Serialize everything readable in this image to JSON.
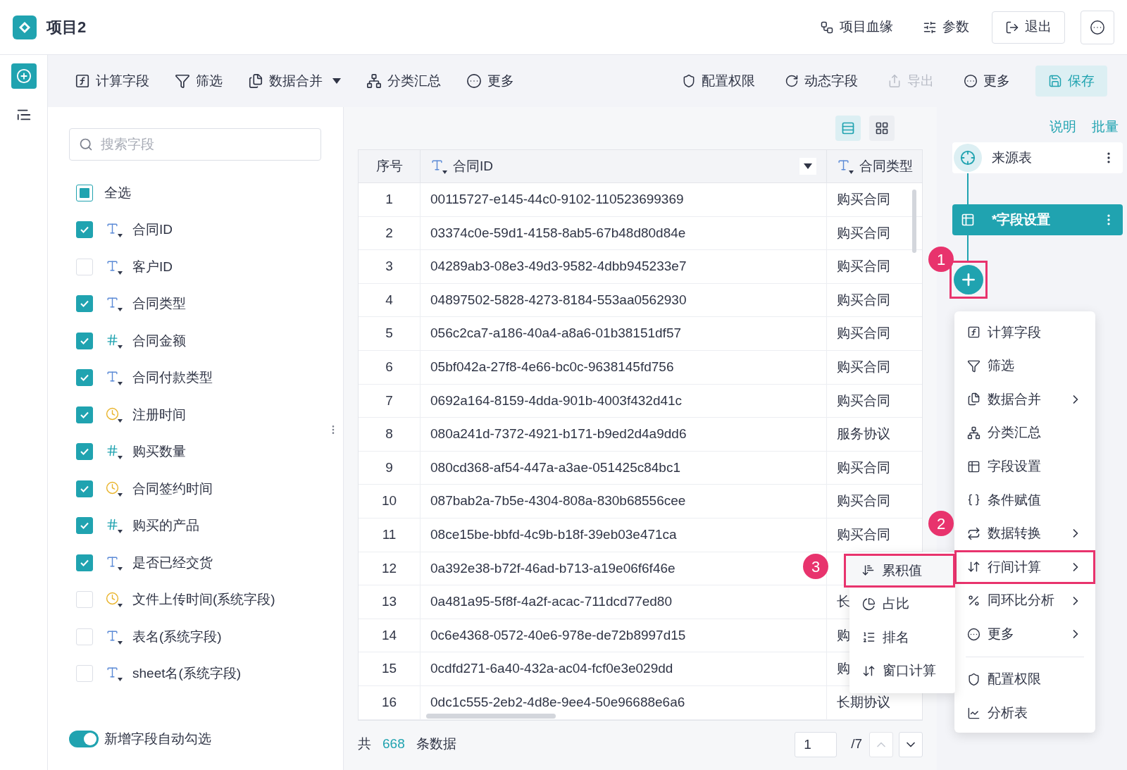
{
  "header": {
    "title": "项目2",
    "actions": [
      {
        "label": "项目血缘",
        "kind": "link"
      },
      {
        "label": "参数",
        "kind": "link"
      },
      {
        "label": "退出",
        "kind": "button"
      }
    ]
  },
  "toolbar": {
    "left": [
      {
        "label": "计算字段",
        "dropdown": false
      },
      {
        "label": "筛选",
        "dropdown": false
      },
      {
        "label": "数据合并",
        "dropdown": true
      },
      {
        "label": "分类汇总",
        "dropdown": false
      },
      {
        "label": "更多",
        "dropdown": false
      }
    ],
    "right": [
      {
        "label": "配置权限",
        "kind": "plain",
        "disabled": false
      },
      {
        "label": "动态字段",
        "kind": "plain",
        "disabled": false
      },
      {
        "label": "导出",
        "kind": "plain",
        "disabled": true
      },
      {
        "label": "更多",
        "kind": "plain",
        "disabled": false
      },
      {
        "label": "保存",
        "kind": "primary",
        "disabled": false
      }
    ]
  },
  "fields": {
    "search": {
      "placeholder": "搜索字段"
    },
    "select_all": {
      "label": "全选",
      "checked": false,
      "indeterminate": true
    },
    "items": [
      {
        "label": "合同ID",
        "kind": "text",
        "checked": true
      },
      {
        "label": "客户ID",
        "kind": "text",
        "checked": false
      },
      {
        "label": "合同类型",
        "kind": "text",
        "checked": true
      },
      {
        "label": "合同金额",
        "kind": "number",
        "checked": true
      },
      {
        "label": "合同付款类型",
        "kind": "text",
        "checked": true
      },
      {
        "label": "注册时间",
        "kind": "date",
        "checked": true
      },
      {
        "label": "购买数量",
        "kind": "number",
        "checked": true
      },
      {
        "label": "合同签约时间",
        "kind": "date",
        "checked": true
      },
      {
        "label": "购买的产品",
        "kind": "number",
        "checked": true
      },
      {
        "label": "是否已经交货",
        "kind": "text",
        "checked": true
      },
      {
        "label": "文件上传时间(系统字段)",
        "kind": "date",
        "checked": false
      },
      {
        "label": "表名(系统字段)",
        "kind": "text",
        "checked": false
      },
      {
        "label": "sheet名(系统字段)",
        "kind": "text",
        "checked": false
      }
    ],
    "auto_check": {
      "label": "新增字段自动勾选",
      "on": true
    }
  },
  "views": [
    {
      "kind": "list",
      "selected": true
    },
    {
      "kind": "grid",
      "selected": false
    }
  ],
  "table": {
    "columns": [
      {
        "label": "序号",
        "kind": "index",
        "filter": false
      },
      {
        "label": "合同ID",
        "kind": "text",
        "filter": true
      },
      {
        "label": "合同类型",
        "kind": "text",
        "filter": false
      }
    ],
    "rows": [
      [
        "1",
        "00115727-e145-44c0-9102-110523699369",
        "购买合同"
      ],
      [
        "2",
        "03374c0e-59d1-4158-8ab5-67b48d80d84e",
        "购买合同"
      ],
      [
        "3",
        "04289ab3-08e3-49d3-9582-4dbb945233e7",
        "购买合同"
      ],
      [
        "4",
        "04897502-5828-4273-8184-553aa0562930",
        "购买合同"
      ],
      [
        "5",
        "056c2ca7-a186-40a4-a8a6-01b38151df57",
        "购买合同"
      ],
      [
        "6",
        "05bf042a-27f8-4e66-bc0c-9638145fd756",
        "购买合同"
      ],
      [
        "7",
        "0692a164-8159-4dda-901b-4003f432d41c",
        "购买合同"
      ],
      [
        "8",
        "080a241d-7372-4921-b171-b9ed2d4a9dd6",
        "服务协议"
      ],
      [
        "9",
        "080cd368-af54-447a-a3ae-051425c84bc1",
        "购买合同"
      ],
      [
        "10",
        "087bab2a-7b5e-4304-808a-830b68556cee",
        "购买合同"
      ],
      [
        "11",
        "08ce15be-bbfd-4c9b-b18f-39eb03e471ca",
        "购买合同"
      ],
      [
        "12",
        "0a392e38-b72f-46ad-b713-a19e06f6f46e"
      ],
      [
        "13",
        "0a481a95-5f8f-4a2f-acac-711dcd77ed80",
        "长"
      ],
      [
        "14",
        "0c6e4368-0572-40e6-978e-de72b8997d15",
        "购"
      ],
      [
        "15",
        "0cdfd271-6a40-432a-ac04-fcf0e3e029dd",
        "购"
      ],
      [
        "16",
        "0dc1c555-2eb2-4d8e-9ee4-50e96688e6a6",
        "长期协议"
      ]
    ]
  },
  "footer": {
    "prefix": "共",
    "count": "668",
    "suffix": "条数据",
    "page": "1",
    "pages": "/7"
  },
  "flow": {
    "links": [
      "说明",
      "批量"
    ],
    "nodes": [
      {
        "label": "来源表",
        "kind": "source",
        "selected": false
      },
      {
        "label": "*字段设置",
        "kind": "fields",
        "selected": true
      }
    ]
  },
  "menu": {
    "items": [
      {
        "label": "计算字段",
        "submenu": false,
        "highlighted": false
      },
      {
        "label": "筛选",
        "submenu": false,
        "highlighted": false
      },
      {
        "label": "数据合并",
        "submenu": true,
        "highlighted": false
      },
      {
        "label": "分类汇总",
        "submenu": false,
        "highlighted": false
      },
      {
        "label": "字段设置",
        "submenu": false,
        "highlighted": false
      },
      {
        "label": "条件赋值",
        "submenu": false,
        "highlighted": false
      },
      {
        "label": "数据转换",
        "submenu": true,
        "highlighted": false
      },
      {
        "label": "行间计算",
        "submenu": true,
        "highlighted": true
      },
      {
        "label": "同环比分析",
        "submenu": true,
        "highlighted": false
      },
      {
        "label": "更多",
        "submenu": true,
        "highlighted": false
      }
    ],
    "footer_items": [
      {
        "label": "配置权限"
      },
      {
        "label": "分析表"
      }
    ]
  },
  "submenu": {
    "items": [
      {
        "label": "累积值",
        "highlighted": true
      },
      {
        "label": "占比",
        "highlighted": false
      },
      {
        "label": "排名",
        "highlighted": false
      },
      {
        "label": "窗口计算",
        "highlighted": false
      }
    ]
  },
  "callouts": [
    "1",
    "2",
    "3"
  ]
}
